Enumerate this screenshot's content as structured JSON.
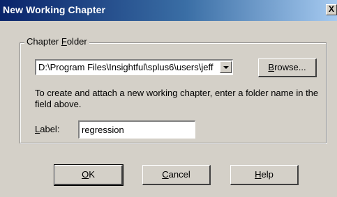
{
  "window": {
    "title": "New Working Chapter",
    "close_label": "X"
  },
  "chapter_folder": {
    "group_label_prefix": "Chapter ",
    "group_label_accel": "F",
    "group_label_rest": "older",
    "path_value": "D:\\Program Files\\Insightful\\splus6\\users\\jeff",
    "browse_label_accel": "B",
    "browse_label_rest": "rowse...",
    "instructions": "To create and attach a new working chapter, enter a folder name in the field above."
  },
  "label_field": {
    "caption_accel": "L",
    "caption_rest": "abel:",
    "value": "regression"
  },
  "buttons": {
    "ok_accel": "O",
    "ok_rest": "K",
    "cancel_accel": "C",
    "cancel_rest": "ancel",
    "help_accel": "H",
    "help_rest": "elp"
  },
  "icons": {
    "close": "close-icon",
    "dropdown": "chevron-down-icon"
  }
}
